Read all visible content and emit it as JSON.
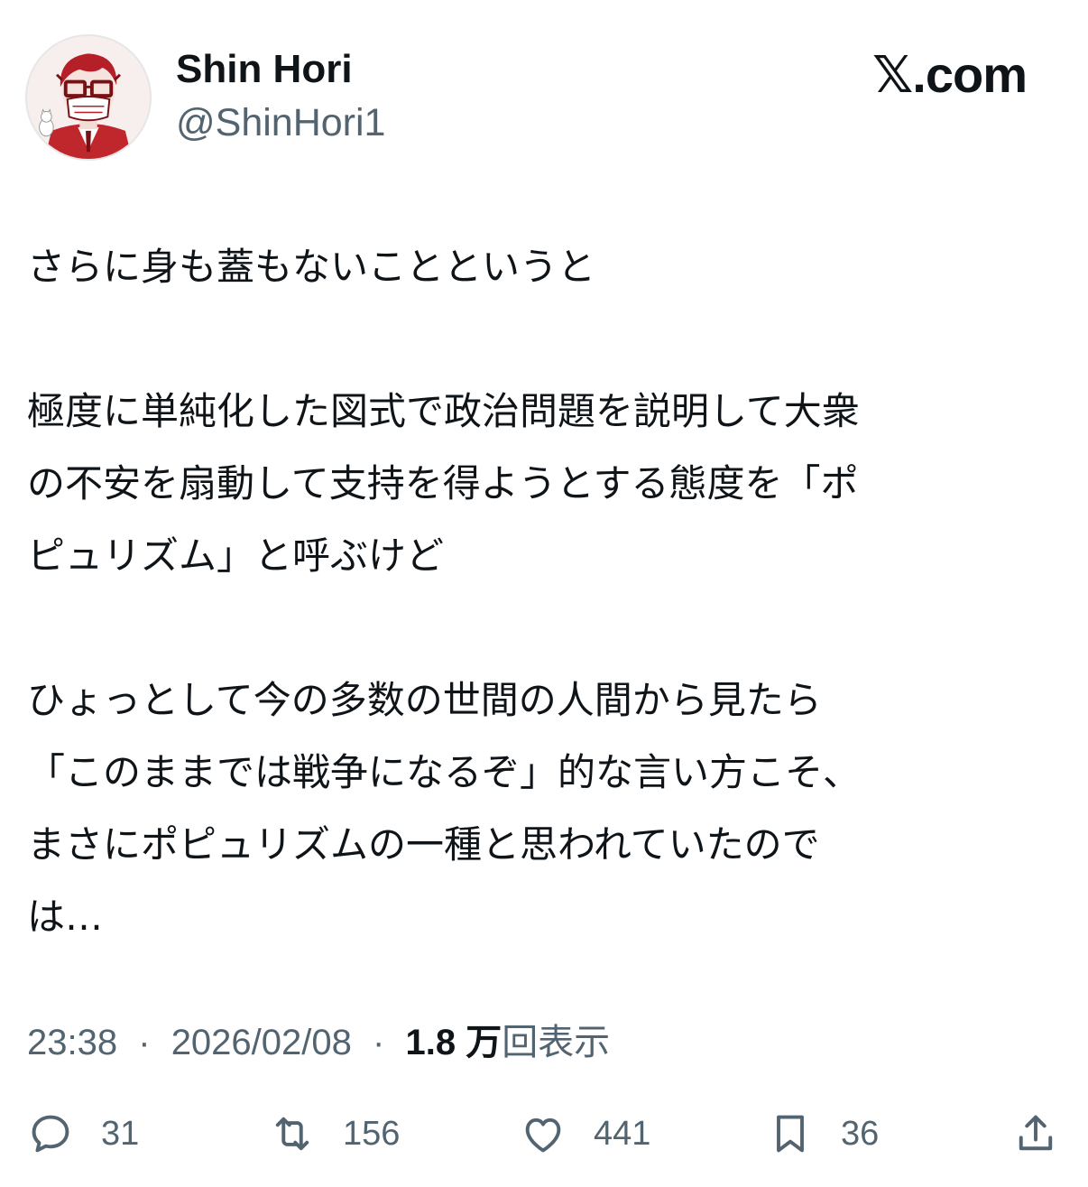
{
  "author": {
    "display_name": "Shin Hori",
    "handle": "@ShinHori1",
    "avatar_icon": "avatar-illustration"
  },
  "brand": {
    "label": "𝕏.com"
  },
  "tweet": {
    "paragraphs": [
      {
        "lines": [
          "さらに身も蓋もないことというと"
        ]
      },
      {
        "lines": [
          "極度に単純化した図式で政治問題を説明して大衆",
          "の不安を扇動して支持を得ようとする態度を「ポ",
          "ピュリズム」と呼ぶけど"
        ]
      },
      {
        "lines": [
          "ひょっとして今の多数の世間の人間から見たら",
          "「このままでは戦争になるぞ」的な言い方こそ、",
          "まさにポピュリズムの一種と思われていたので",
          "は…"
        ]
      }
    ]
  },
  "meta": {
    "time": "23:38",
    "separator": "·",
    "date": "2026/02/08",
    "views_count": "1.8 万",
    "views_label": "回表示"
  },
  "actions": {
    "reply": {
      "icon": "reply-icon",
      "count": "31"
    },
    "repost": {
      "icon": "repost-icon",
      "count": "156"
    },
    "like": {
      "icon": "heart-icon",
      "count": "441"
    },
    "bookmark": {
      "icon": "bookmark-icon",
      "count": "36"
    },
    "share": {
      "icon": "share-icon"
    }
  },
  "colors": {
    "text_primary": "#0f1419",
    "text_secondary": "#536471",
    "avatar_accent": "#c0272d"
  }
}
